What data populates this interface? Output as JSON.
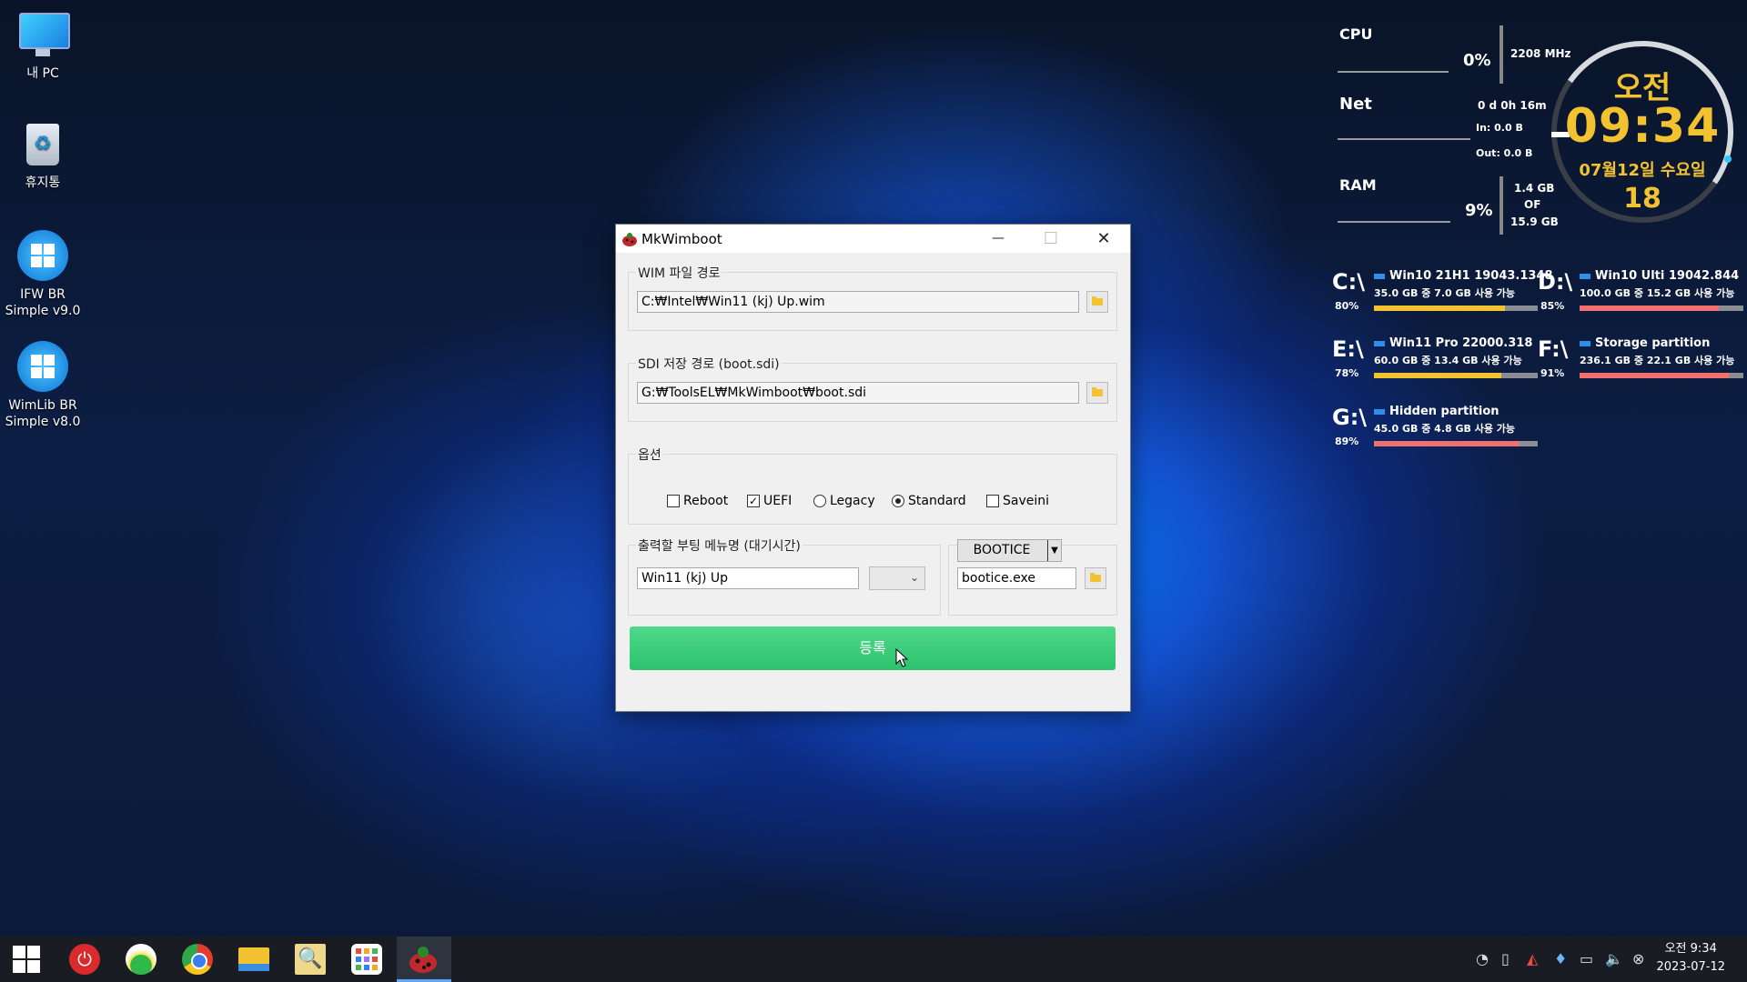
{
  "desktop": {
    "icons": [
      {
        "label": "내 PC"
      },
      {
        "label": "휴지통"
      },
      {
        "label_line1": "IFW BR",
        "label_line2": "Simple v9.0"
      },
      {
        "label_line1": "WimLib BR",
        "label_line2": "Simple v8.0"
      }
    ]
  },
  "widgets": {
    "cpu": {
      "label": "CPU",
      "percent": "0%",
      "freq": "2208 MHz"
    },
    "net": {
      "label": "Net",
      "uptime": "0 d 0h 16m",
      "in": "In: 0.0 B",
      "out": "Out: 0.0 B"
    },
    "ram": {
      "label": "RAM",
      "percent": "9%",
      "used": "1.4 GB",
      "of": "OF",
      "total": "15.9 GB"
    },
    "clock": {
      "ampm": "오전",
      "time": "09:34",
      "date": "07월12일 수요일",
      "day": "18"
    },
    "drives": [
      {
        "letter": "C:\\",
        "percent": "80%",
        "name": "Win10 21H1 19043.1348",
        "info": "35.0 GB 중    7.0 GB 사용 가능",
        "fill": 0.8,
        "color": "#f2c230"
      },
      {
        "letter": "D:\\",
        "percent": "85%",
        "name": "Win10 Ulti 19042.844",
        "info": "100.0 GB 중  15.2 GB 사용 가능",
        "fill": 0.85,
        "color": "#f07070"
      },
      {
        "letter": "E:\\",
        "percent": "78%",
        "name": "Win11 Pro 22000.318",
        "info": "60.0 GB 중    13.4 GB 사용 가능",
        "fill": 0.78,
        "color": "#f2c230"
      },
      {
        "letter": "F:\\",
        "percent": "91%",
        "name": "Storage partition",
        "info": "236.1 GB 중  22.1 GB 사용 가능",
        "fill": 0.91,
        "color": "#f07070"
      },
      {
        "letter": "G:\\",
        "percent": "89%",
        "name": "Hidden partition",
        "info": "45.0 GB 중    4.8 GB 사용 가능",
        "fill": 0.89,
        "color": "#f07070"
      }
    ]
  },
  "window": {
    "title": "MkWimboot",
    "minimize": "—",
    "maximize": "☐",
    "close": "✕",
    "wim": {
      "label": "WIM 파일 경로",
      "value": "C:₩Intel₩Win11 (kj) Up.wim"
    },
    "sdi": {
      "label": "SDI 저장 경로 (boot.sdi)",
      "value": "G:₩ToolsEL₩MkWimboot₩boot.sdi"
    },
    "options": {
      "label": "옵션",
      "reboot": {
        "label": "Reboot",
        "checked": false
      },
      "uefi": {
        "label": "UEFI",
        "checked": true
      },
      "legacy": {
        "label": "Legacy",
        "selected": false
      },
      "standard": {
        "label": "Standard",
        "selected": true
      },
      "saveini": {
        "label": "Saveini",
        "checked": false
      }
    },
    "menu": {
      "label": "출력할 부팅 메뉴명 (대기시간)",
      "value": "Win11 (kj) Up",
      "timeout": ""
    },
    "tool": {
      "button": "BOOTICE",
      "value": "bootice.exe"
    },
    "register": "등록"
  },
  "taskbar": {
    "clock_time": "오전 9:34",
    "clock_date": "2023-07-12",
    "apps": [
      "start-icon",
      "power-icon",
      "photos-icon",
      "chrome-icon",
      "file-explorer-icon",
      "search-tool-icon",
      "apps-grid-icon",
      "mkwimboot-icon"
    ],
    "tray": [
      "network-icon",
      "usb-icon",
      "chart-icon",
      "drop-icon",
      "battery-icon",
      "volume-icon",
      "close-circle-icon"
    ]
  }
}
